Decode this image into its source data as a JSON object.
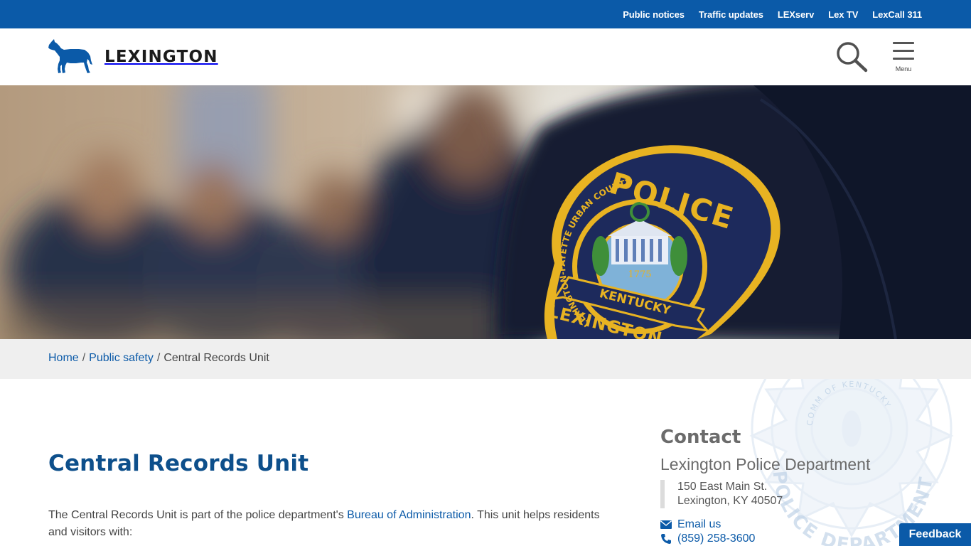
{
  "utility_nav": {
    "links": [
      {
        "label": "Public notices"
      },
      {
        "label": "Traffic updates"
      },
      {
        "label": "LEXserv"
      },
      {
        "label": "Lex TV"
      },
      {
        "label": "LexCall 311"
      }
    ]
  },
  "header": {
    "logo_text": "LEXINGTON",
    "logo_icon": "horse-icon",
    "search_icon": "search-icon",
    "menu_label": "Menu",
    "menu_icon": "hamburger-icon"
  },
  "hero": {
    "patch_top_text": "POLICE",
    "patch_bottom_text": "LEXINGTON",
    "patch_ring_text": "LEXINGTON-FAYETTE URBAN COUNTY",
    "patch_banner_text": "KENTUCKY",
    "patch_year": "1775"
  },
  "breadcrumb": {
    "items": [
      {
        "label": "Home"
      },
      {
        "label": "Public safety"
      }
    ],
    "separator": "/",
    "current": "Central Records Unit"
  },
  "main": {
    "title": "Central Records Unit",
    "intro_before": "The Central Records Unit is part of the police department's ",
    "intro_link": "Bureau of Administration",
    "intro_after": ". This unit helps residents and visitors with:"
  },
  "contact": {
    "heading": "Contact",
    "organization": "Lexington Police Department",
    "address_line1": "150 East Main St.",
    "address_line2": "Lexington, KY  40507",
    "email_label": "Email us",
    "email_icon": "envelope-icon",
    "phone": "(859) 258-3600",
    "phone_icon": "phone-icon"
  },
  "watermark": {
    "badge_text": "POLICE DEPARTMENT",
    "seal_text": "COMM OF KENTUCKY"
  },
  "feedback": {
    "label": "Feedback"
  },
  "colors": {
    "brand_blue": "#0b5aa8",
    "title_blue": "#0d4f8b",
    "breadcrumb_bg": "#efefef",
    "patch_navy": "#1d2a5c",
    "patch_gold": "#e8b322"
  }
}
